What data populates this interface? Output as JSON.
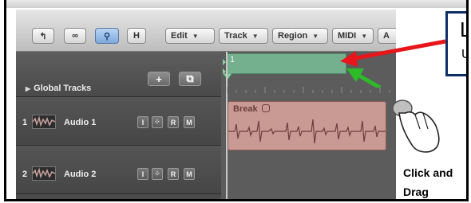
{
  "toolbar": {
    "buttons": [
      "H"
    ],
    "menus": [
      {
        "label": "Edit"
      },
      {
        "label": "Track"
      },
      {
        "label": "Region"
      },
      {
        "label": "MIDI"
      },
      {
        "label": "A"
      }
    ]
  },
  "global_tracks": {
    "label": "Global Tracks",
    "add_button": "+"
  },
  "arrange": {
    "bar_number": "1"
  },
  "tracks": [
    {
      "number": "1",
      "name": "Audio 1",
      "buttons": [
        "I",
        "R",
        "M"
      ]
    },
    {
      "number": "2",
      "name": "Audio 2",
      "buttons": [
        "I",
        "R",
        "M"
      ]
    }
  ],
  "region": {
    "name": "Break"
  },
  "callout": {
    "title_letter": "L",
    "subtitle_letter": "U"
  },
  "annotation": {
    "line1": "Click and",
    "line2": "Drag"
  },
  "colors": {
    "region_green": "#74b08d",
    "region_audio": "#c99a94",
    "arrow_red": "#e8161b",
    "arrow_green": "#2dbb2a"
  }
}
